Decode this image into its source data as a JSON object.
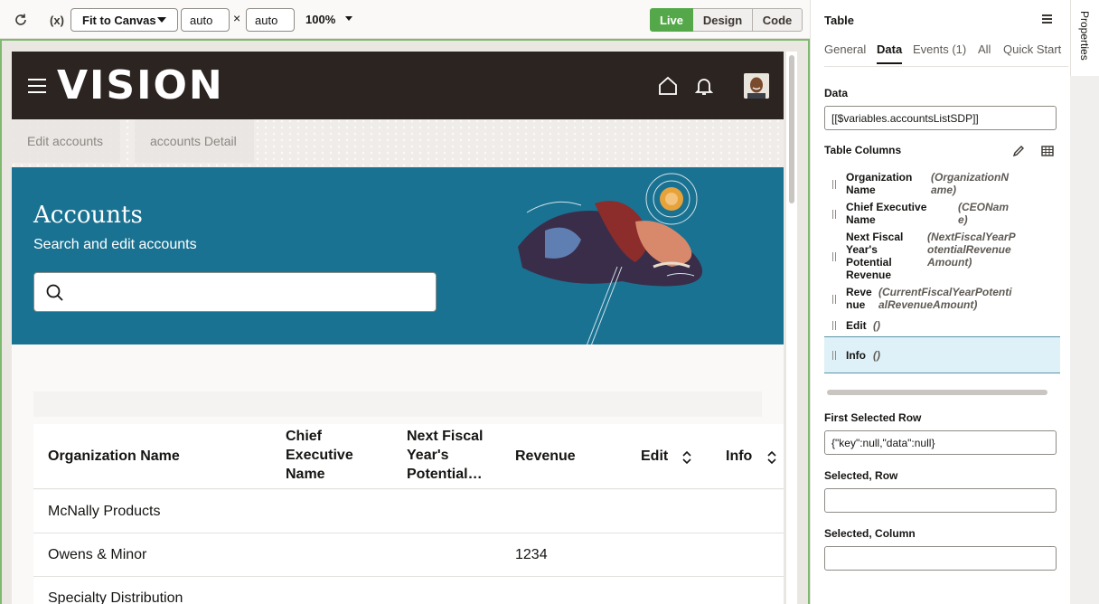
{
  "toolbar": {
    "refresh_icon": "refresh-icon",
    "variables_icon": "variables-icon",
    "variables_label": "(x)",
    "fit_label": "Fit to Canvas",
    "width_value": "auto",
    "height_value": "auto",
    "times": "×",
    "zoom": "100%",
    "modes": {
      "live": "Live",
      "design": "Design",
      "code": "Code"
    },
    "live_color": "#55a849"
  },
  "app": {
    "logo": "VISION",
    "tabs": [
      "Edit accounts",
      "accounts Detail"
    ],
    "hero": {
      "title": "Accounts",
      "subtitle": "Search and edit accounts",
      "search_placeholder": ""
    },
    "table": {
      "columns": [
        "Organization Name",
        "Chief Executive Name",
        "Next Fiscal Year's Potential…",
        "Revenue",
        "Edit",
        "Info"
      ],
      "rows": [
        {
          "org": "McNally Products",
          "revenue": ""
        },
        {
          "org": "Owens & Minor",
          "revenue": "1234"
        },
        {
          "org": "Specialty Distribution",
          "revenue": ""
        }
      ]
    },
    "header_bg": "#2c2420",
    "hero_bg": "#1a7292"
  },
  "panel": {
    "title": "Table",
    "tabs": [
      "General",
      "Data",
      "Events (1)",
      "All",
      "Quick Start"
    ],
    "active_tab": "Data",
    "data_label": "Data",
    "data_value": "[[$variables.accountsListSDP]]",
    "columns_label": "Table Columns",
    "columns": [
      {
        "name": "Organization Name",
        "field": "(OrganizationName)"
      },
      {
        "name": "Chief Executive Name",
        "field": "(CEOName)"
      },
      {
        "name": "Next Fiscal Year's Potential Revenue",
        "field": "(NextFiscalYearPotentialRevenueAmount)"
      },
      {
        "name": "Revenue",
        "field": "(CurrentFiscalYearPotentialRevenueAmount)"
      },
      {
        "name": "Edit",
        "field": "()"
      },
      {
        "name": "Info",
        "field": "()"
      }
    ],
    "first_selected_row_label": "First Selected Row",
    "first_selected_row_value": "{\"key\":null,\"data\":null}",
    "selected_row_label": "Selected, Row",
    "selected_row_value": "",
    "selected_column_label": "Selected, Column",
    "selected_column_value": "",
    "side_tab": "Properties"
  }
}
